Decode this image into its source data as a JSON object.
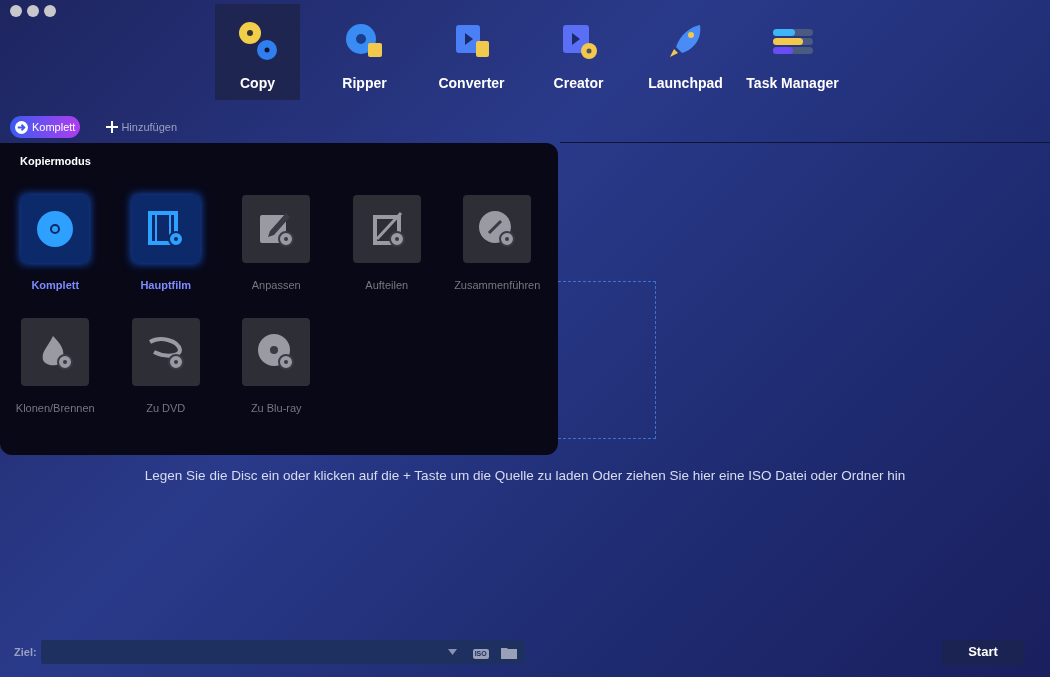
{
  "nav": [
    {
      "label": "Copy",
      "selected": true,
      "kind": "copy"
    },
    {
      "label": "Ripper",
      "selected": false,
      "kind": "ripper"
    },
    {
      "label": "Converter",
      "selected": false,
      "kind": "converter"
    },
    {
      "label": "Creator",
      "selected": false,
      "kind": "creator"
    },
    {
      "label": "Launchpad",
      "selected": false,
      "kind": "launchpad"
    },
    {
      "label": "Task Manager",
      "selected": false,
      "kind": "tasks"
    }
  ],
  "mode_button": "Komplett",
  "add_button": "Hinzufügen",
  "mode_panel": {
    "title": "Kopiermodus",
    "items": [
      {
        "label": "Komplett",
        "active": true,
        "kind": "disc"
      },
      {
        "label": "Hauptfilm",
        "active": true,
        "kind": "film"
      },
      {
        "label": "Anpassen",
        "active": false,
        "kind": "edit"
      },
      {
        "label": "Aufteilen",
        "active": false,
        "kind": "crop"
      },
      {
        "label": "Zusammenführen",
        "active": false,
        "kind": "link"
      },
      {
        "label": "Klonen/Brennen",
        "active": false,
        "kind": "fire"
      },
      {
        "label": "Zu DVD",
        "active": false,
        "kind": "bluray"
      },
      {
        "label": "Zu Blu-ray",
        "active": false,
        "kind": "discbd"
      }
    ]
  },
  "hint": "Legen Sie die Disc ein oder klicken auf die + Taste um die Quelle zu laden Oder ziehen Sie hier eine ISO Datei oder Ordner hin",
  "target": {
    "label": "Ziel:",
    "iso_icon": "ISO"
  },
  "start_button": "Start"
}
